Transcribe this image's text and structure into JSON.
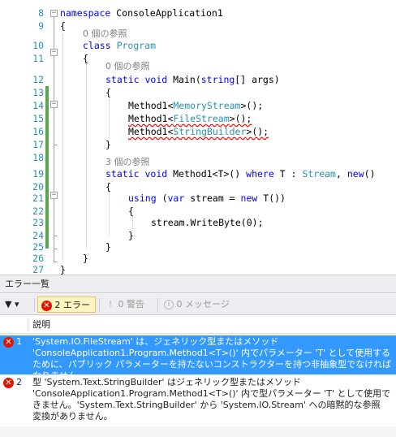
{
  "editor": {
    "ref_0": "0 個の参照",
    "ref_0b": "0 個の参照",
    "ref_3": "3 個の参照",
    "lines": {
      "l8": {
        "num": "8",
        "kw": "namespace",
        "rest": " ConsoleApplication1"
      },
      "l9": {
        "num": "9",
        "text": "{"
      },
      "l10": {
        "num": "10",
        "kw": "class",
        "type": "Program"
      },
      "l11": {
        "num": "11",
        "text": "{"
      },
      "l12": {
        "num": "12",
        "kw1": "static",
        "kw2": "void",
        "rest": "Main(",
        "kw3": "string",
        "rest2": "[] args)"
      },
      "l13": {
        "num": "13",
        "text": "{"
      },
      "l14": {
        "num": "14",
        "pre": "Method1<",
        "type": "MemoryStream",
        "post": ">();"
      },
      "l15": {
        "num": "15",
        "pre": "Method1<",
        "type": "FileStream",
        "post": ">();"
      },
      "l16": {
        "num": "16",
        "pre": "Method1<",
        "type": "StringBuilder",
        "post": ">();"
      },
      "l17": {
        "num": "17",
        "text": "}"
      },
      "l18": {
        "num": "18",
        "text": ""
      },
      "l19": {
        "num": "19",
        "kw1": "static",
        "kw2": "void",
        "rest": "Method1<T>()",
        "kw3": "where",
        "rest2": "T :",
        "type": "Stream",
        "rest3": ",",
        "kw4": "new",
        "rest4": "()"
      },
      "l20": {
        "num": "20",
        "text": "{"
      },
      "l21": {
        "num": "21",
        "kw1": "using",
        "rest": "(",
        "kw2": "var",
        "rest2": "stream =",
        "kw3": "new",
        "rest3": "T())"
      },
      "l22": {
        "num": "22",
        "text": "{"
      },
      "l23": {
        "num": "23",
        "pre": "stream.WriteByte(",
        "num0": "0",
        "post": ");"
      },
      "l24": {
        "num": "24",
        "text": "}"
      },
      "l25": {
        "num": "25",
        "text": "}"
      },
      "l26": {
        "num": "26",
        "text": "}"
      },
      "l27": {
        "num": "27",
        "text": "}"
      }
    }
  },
  "error_list": {
    "title": "エラー一覧",
    "filter_label": "▼ ▾",
    "errors_label": "2 エラー",
    "warnings_label": "0 警告",
    "messages_label": "0 メッセージ",
    "column_description": "説明",
    "rows": [
      {
        "num": "1",
        "selected": true,
        "description": "'System.IO.FileStream' は、ジェネリック型またはメソッド\n'ConsoleApplication1.Program.Method1<T>()' 内でパラメーター 'T' として使用する\nために、パブリック パラメーターを持たないコンストラクターを持つ非抽象型でなければなりません"
      },
      {
        "num": "2",
        "selected": false,
        "description": "型 'System.Text.StringBuilder' はジェネリック型またはメソッド\n'ConsoleApplication1.Program.Method1<T>()' 内で型パラメーター 'T' として使用で\nきません。'System.Text.StringBuilder' から 'System.IO.Stream' への暗黙的な参照\n変換がありません。"
      }
    ]
  },
  "colors": {
    "keyword": "#0000ff",
    "type": "#2b91af",
    "line_number": "#2b91af",
    "selection": "#3399ff",
    "error": "#e51400",
    "change_bar": "#57a64a"
  }
}
